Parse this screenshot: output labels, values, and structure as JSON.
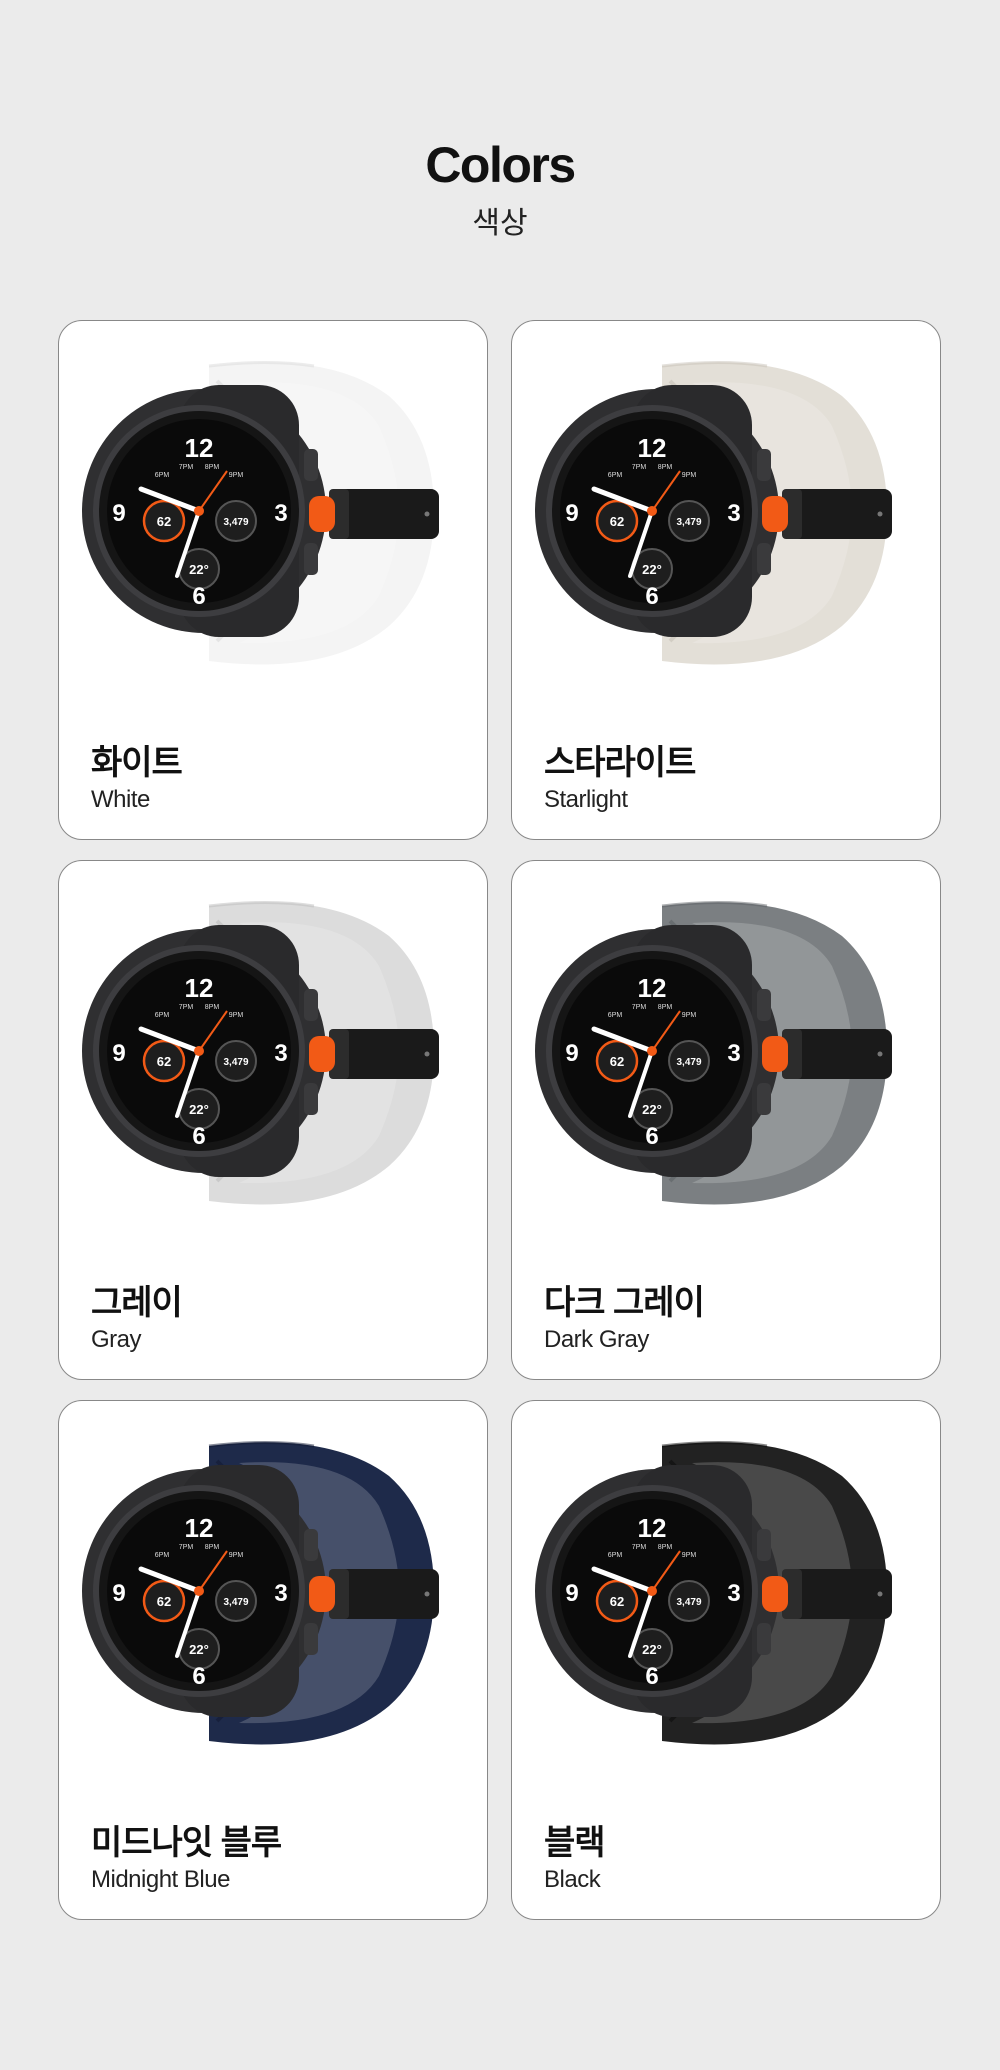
{
  "header": {
    "title": "Colors",
    "subtitle": "색상"
  },
  "watch_face": {
    "twelve": "12",
    "three": "3",
    "six": "6",
    "nine": "9",
    "heart_rate": "62",
    "steps": "3,479",
    "temp": "22°",
    "t6": "6PM",
    "t7": "7PM",
    "t8": "8PM",
    "t9": "9PM"
  },
  "products": [
    {
      "name_ko": "화이트",
      "name_en": "White",
      "band_color": "#f4f4f4",
      "band_shade": "#d9d9d9"
    },
    {
      "name_ko": "스타라이트",
      "name_en": "Starlight",
      "band_color": "#e3dfd7",
      "band_shade": "#c7c2b8"
    },
    {
      "name_ko": "그레이",
      "name_en": "Gray",
      "band_color": "#dcdcdc",
      "band_shade": "#bcbcbc"
    },
    {
      "name_ko": "다크 그레이",
      "name_en": "Dark Gray",
      "band_color": "#7b7f82",
      "band_shade": "#5e6265"
    },
    {
      "name_ko": "미드나잇 블루",
      "name_en": "Midnight Blue",
      "band_color": "#1e2a4a",
      "band_shade": "#121a33"
    },
    {
      "name_ko": "블랙",
      "name_en": "Black",
      "band_color": "#222222",
      "band_shade": "#0e0e0e"
    }
  ]
}
